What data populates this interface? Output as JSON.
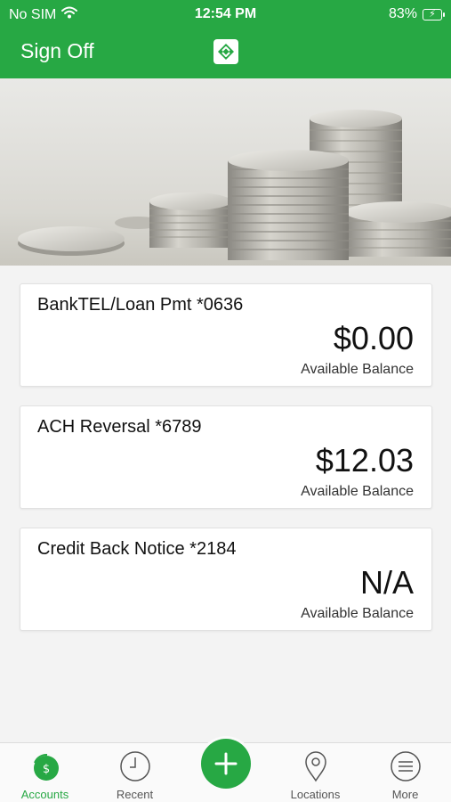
{
  "status_bar": {
    "carrier": "No SIM",
    "time": "12:54 PM",
    "battery_percent": "83%",
    "wifi_icon": "wifi-icon",
    "battery_icon": "battery-charging-icon"
  },
  "nav": {
    "sign_off_label": "Sign Off",
    "logo_icon": "bank-logo-icon"
  },
  "hero": {
    "image": "coins-stack-photo"
  },
  "accounts": [
    {
      "name": "BankTEL/Loan Pmt *0636",
      "amount": "$0.00",
      "label": "Available Balance"
    },
    {
      "name": "ACH Reversal *6789",
      "amount": "$12.03",
      "label": "Available Balance"
    },
    {
      "name": "Credit Back Notice *2184",
      "amount": "N/A",
      "label": "Available Balance"
    }
  ],
  "tabbar": {
    "tabs": [
      {
        "label": "Accounts",
        "icon": "dollar-circle-icon",
        "active": true
      },
      {
        "label": "Recent",
        "icon": "clock-icon",
        "active": false
      },
      {
        "label": "Locations",
        "icon": "map-pin-icon",
        "active": false
      },
      {
        "label": "More",
        "icon": "menu-icon",
        "active": false
      }
    ],
    "fab_icon": "plus-icon"
  },
  "colors": {
    "brand_green": "#27a844",
    "background": "#f3f3f3",
    "card": "#ffffff"
  }
}
